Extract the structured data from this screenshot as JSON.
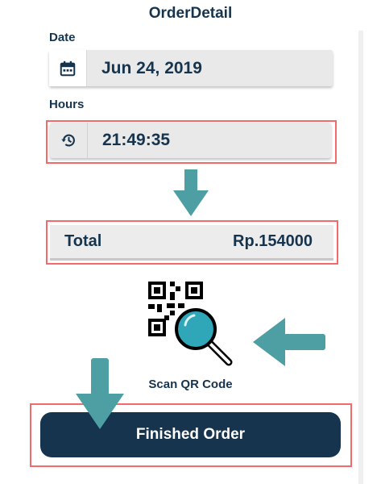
{
  "header": {
    "title": "OrderDetail"
  },
  "date": {
    "label": "Date",
    "value": "Jun 24, 2019",
    "icon": "calendar-icon"
  },
  "hours": {
    "label": "Hours",
    "value": "21:49:35",
    "icon": "history-icon"
  },
  "total": {
    "label": "Total",
    "amount": "Rp.154000"
  },
  "scan": {
    "label": "Scan QR Code",
    "icon": "qr-scan-icon"
  },
  "actions": {
    "finish_label": "Finished Order"
  },
  "colors": {
    "primary": "#16344d",
    "highlight": "#f36a6a",
    "arrow": "#4e9fa3",
    "field": "#e9e9e9"
  }
}
